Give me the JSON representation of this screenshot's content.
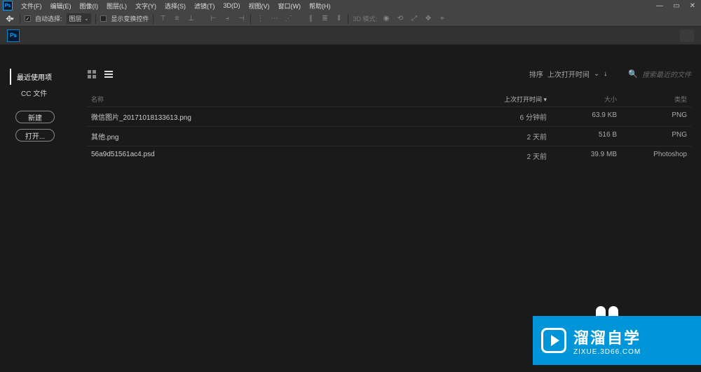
{
  "app": {
    "logo_text": "Ps"
  },
  "menu": {
    "items": [
      "文件(F)",
      "编辑(E)",
      "图像(I)",
      "图层(L)",
      "文字(Y)",
      "选择(S)",
      "滤镜(T)",
      "3D(D)",
      "视图(V)",
      "窗口(W)",
      "帮助(H)"
    ]
  },
  "window_controls": {
    "minimize": "—",
    "restore": "▭",
    "close": "✕"
  },
  "options": {
    "auto_select_label": "自动选择:",
    "select_target": "图层",
    "show_transform_label": "显示变换控件",
    "mode_3d_label": "3D 模式:"
  },
  "sidebar": {
    "recent": "最近使用项",
    "cc_files": "CC 文件",
    "new_btn": "新建",
    "open_btn": "打开..."
  },
  "sort": {
    "label": "排序",
    "option": "上次打开时间",
    "chevron": "⌄",
    "arrow": "↓"
  },
  "search": {
    "icon": "🔍",
    "placeholder": "搜索最近的文件"
  },
  "columns": {
    "name": "名称",
    "time": "上次打开时间 ▾",
    "size": "大小",
    "type": "类型"
  },
  "files": [
    {
      "name": "微信图片_20171018133613.png",
      "time": "6 分钟前",
      "size": "63.9 KB",
      "type": "PNG"
    },
    {
      "name": "其他.png",
      "time": "2 天前",
      "size": "516 B",
      "type": "PNG"
    },
    {
      "name": "56a9d51561ac4.psd",
      "time": "2 天前",
      "size": "39.9 MB",
      "type": "Photoshop"
    }
  ],
  "watermark": {
    "title": "溜溜自学",
    "url": "ZIXUE.3D66.COM"
  }
}
